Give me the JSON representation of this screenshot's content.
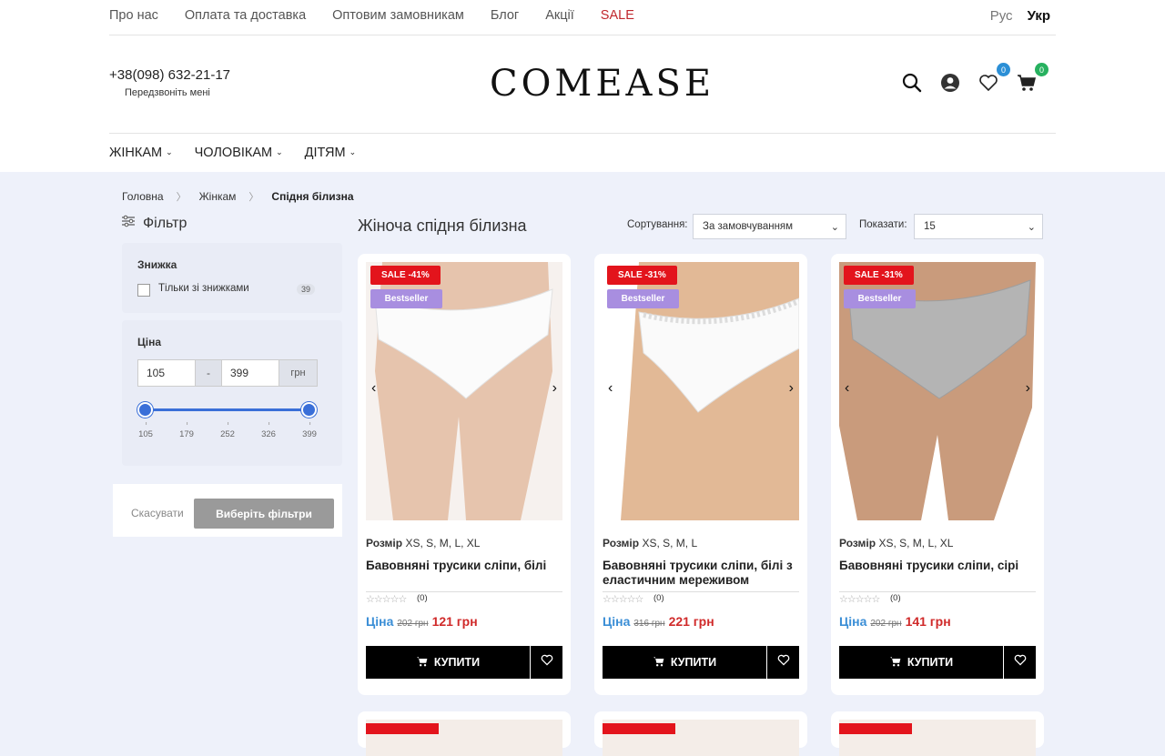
{
  "topnav": [
    "Про нас",
    "Оплата та доставка",
    "Оптовим замовникам",
    "Блог",
    "Акції",
    "SALE"
  ],
  "langs": {
    "ru": "Рус",
    "uk": "Укр"
  },
  "phone": "+38(098) 632-21-17",
  "callback": "Передзвоніть мені",
  "logo": "COMEASE",
  "wishlist_count": "0",
  "cart_count": "0",
  "mainnav": [
    "ЖІНКАМ",
    "ЧОЛОВІКАМ",
    "ДІТЯМ"
  ],
  "breadcrumb": [
    "Головна",
    "Жінкам",
    "Спідня білизна"
  ],
  "filter": {
    "title": "Фільтр",
    "discount_title": "Знижка",
    "discount_option": "Тільки зі знижками",
    "discount_count": "39",
    "price_title": "Ціна",
    "price_from": "105",
    "price_to": "399",
    "price_dash": "-",
    "currency": "грн",
    "ticks": [
      "105",
      "179",
      "252",
      "326",
      "399"
    ],
    "cancel": "Скасувати",
    "apply": "Виберіть фільтри"
  },
  "listing": {
    "title": "Жіноча спідня білизна",
    "sort_label": "Сортування:",
    "sort_value": "За замовчуванням",
    "show_label": "Показати:",
    "show_value": "15"
  },
  "products": [
    {
      "sale": "SALE -41%",
      "best": "Bestseller",
      "size_label": "Розмір",
      "sizes": "XS, S, M, L, XL",
      "name": "Бавовняні трусики сліпи, білі",
      "stars": "☆☆☆☆☆",
      "reviews": "(0)",
      "price_label": "Ціна",
      "old": "202 грн",
      "new": "121 грн",
      "buy": "КУПИТИ",
      "color": "white"
    },
    {
      "sale": "SALE -31%",
      "best": "Bestseller",
      "size_label": "Розмір",
      "sizes": "XS, S, M, L",
      "name": "Бавовняні трусики сліпи, білі з еластичним мереживом",
      "stars": "☆☆☆☆☆",
      "reviews": "(0)",
      "price_label": "Ціна",
      "old": "316 грн",
      "new": "221 грн",
      "buy": "КУПИТИ",
      "color": "white-lace"
    },
    {
      "sale": "SALE -31%",
      "best": "Bestseller",
      "size_label": "Розмір",
      "sizes": "XS, S, M, L, XL",
      "name": "Бавовняні трусики сліпи, сірі",
      "stars": "☆☆☆☆☆",
      "reviews": "(0)",
      "price_label": "Ціна",
      "old": "202 грн",
      "new": "141 грн",
      "buy": "КУПИТИ",
      "color": "grey"
    }
  ],
  "colors": {
    "accent_blue": "#3a6fd8",
    "sale_red": "#e3141c",
    "price_red": "#d02a2a",
    "bestseller": "#a88ee0"
  }
}
